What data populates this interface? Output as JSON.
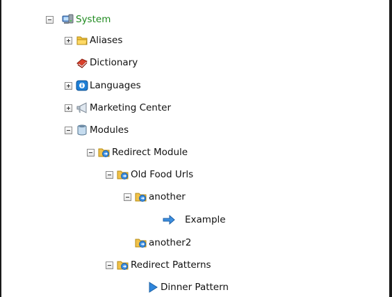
{
  "tree": {
    "items": [
      {
        "label": "System",
        "icon": "system-computer-icon",
        "state": "expanded",
        "selected": true
      },
      {
        "label": "Aliases",
        "icon": "folder-icon",
        "state": "collapsed"
      },
      {
        "label": "Dictionary",
        "icon": "dictionary-book-icon",
        "state": "leaf"
      },
      {
        "label": "Languages",
        "icon": "languages-info-icon",
        "state": "collapsed"
      },
      {
        "label": "Marketing Center",
        "icon": "marketing-center-icon",
        "state": "collapsed"
      },
      {
        "label": "Modules",
        "icon": "modules-jar-icon",
        "state": "expanded"
      },
      {
        "label": "Redirect Module",
        "icon": "redirect-folder-icon",
        "state": "expanded"
      },
      {
        "label": "Old Food Urls",
        "icon": "redirect-folder-icon",
        "state": "expanded"
      },
      {
        "label": "another",
        "icon": "redirect-folder-icon",
        "state": "expanded"
      },
      {
        "label": "Example",
        "icon": "redirect-arrow-icon",
        "state": "leaf"
      },
      {
        "label": "another2",
        "icon": "redirect-folder-icon",
        "state": "leaf"
      },
      {
        "label": "Redirect Patterns",
        "icon": "redirect-folder-icon",
        "state": "expanded"
      },
      {
        "label": "Dinner Pattern",
        "icon": "pattern-triangle-icon",
        "state": "leaf"
      }
    ]
  },
  "colors": {
    "selected_text": "#1f8a1f",
    "frame": "#1a1a1a"
  }
}
